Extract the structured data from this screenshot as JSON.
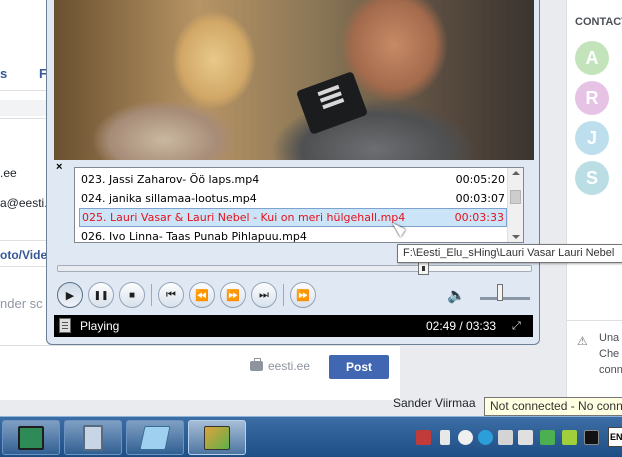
{
  "background_page": {
    "left_fragments": {
      "domain_line": ".ee",
      "email_line": "a@eesti.",
      "nav_item_1": "s",
      "nav_item_2": "F",
      "photo_video_tab": "oto/Video",
      "placeholder_fragment": "nder sc"
    },
    "composer": {
      "privacy_label": "eesti.ee",
      "post_button": "Post"
    },
    "sidebar": {
      "title": "CONTACT",
      "contacts": [
        {
          "initial": "A",
          "color": "#7cc36b"
        },
        {
          "initial": "R",
          "color": "#c879c5"
        },
        {
          "initial": "J",
          "color": "#6fb8d8"
        },
        {
          "initial": "S",
          "color": "#69b8c7"
        }
      ],
      "notice_text_line1": "Una",
      "notice_text_line2": "Che",
      "notice_text_line3": "conn"
    },
    "chat_name": "Sander Viirmaa",
    "not_connected_tooltip": "Not connected - No conn"
  },
  "player": {
    "playlist": [
      {
        "title": "023. Jassi Zaharov- Öö laps.mp4",
        "duration": "00:05:20",
        "selected": false
      },
      {
        "title": "024. janika sillamaa-lootus.mp4",
        "duration": "00:03:07",
        "selected": false
      },
      {
        "title": "025. Lauri Vasar & Lauri Nebel - Kui on meri hülgehall.mp4",
        "duration": "00:03:33",
        "selected": true
      },
      {
        "title": "026. Ivo Linna- Taas Punab Pihlapuu.mp4",
        "duration": "",
        "selected": false
      }
    ],
    "path_tooltip": "F:\\Eesti_Elu_sHing\\Lauri Vasar  Lauri Nebel",
    "seek_progress": 0.7744,
    "volume_level": 0.4,
    "status": {
      "state": "Playing",
      "time": "02:49 / 03:33"
    },
    "icons": {
      "close": "×",
      "play": "▶",
      "pause": "❚❚",
      "stop": "■",
      "previous": "⏮",
      "rewind": "⏪",
      "forward": "⏩",
      "next": "⏭",
      "frame_step": "⏩",
      "volume": "🔈",
      "fullscreen": "⤢"
    }
  },
  "taskbar": {
    "apps": [
      {
        "name": "monitor-app",
        "color": "#2e8b57"
      },
      {
        "name": "calculator-app",
        "color": "#c7d5e6"
      },
      {
        "name": "notepad-app",
        "color": "#9fd0ef"
      },
      {
        "name": "media-player-app",
        "color": "#e0a23c"
      }
    ],
    "keyboard_layout": "EN"
  }
}
